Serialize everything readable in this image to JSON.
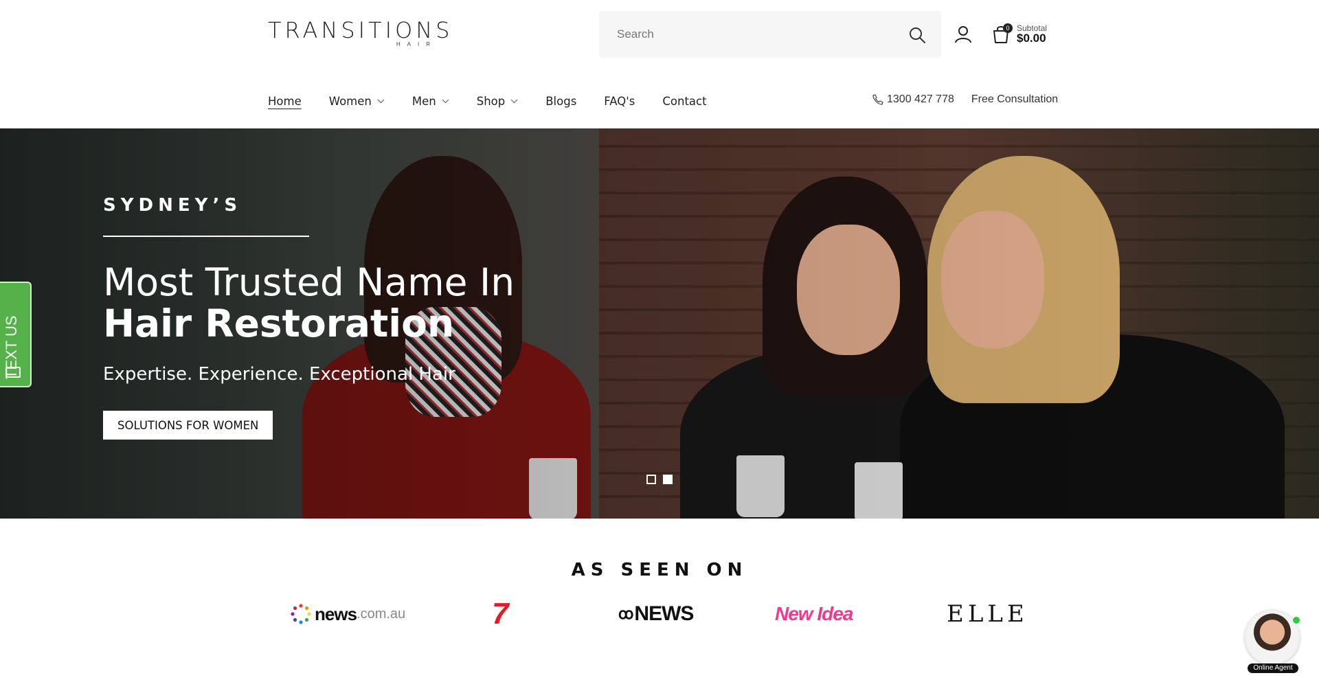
{
  "brand": {
    "name": "TRANSITIONS",
    "sub": "HAIR"
  },
  "search": {
    "placeholder": "Search"
  },
  "cart": {
    "count": "0",
    "subtotal_label": "Subtotal",
    "total": "$0.00"
  },
  "nav": {
    "items": [
      {
        "label": "Home",
        "active": true,
        "dropdown": false
      },
      {
        "label": "Women",
        "dropdown": true
      },
      {
        "label": "Men",
        "dropdown": true
      },
      {
        "label": "Shop",
        "dropdown": true
      },
      {
        "label": "Blogs",
        "dropdown": false
      },
      {
        "label": "FAQ's",
        "dropdown": false
      },
      {
        "label": "Contact",
        "dropdown": false
      }
    ],
    "phone": "1300 427 778",
    "consultation": "Free Consultation"
  },
  "hero": {
    "kicker": "SYDNEY’S",
    "headline_1": "Most Trusted Name In",
    "headline_2": "Hair Restoration",
    "subhead": "Expertise. Experience. Exceptional Hair",
    "cta": "SOLUTIONS FOR WOMEN",
    "slides": 2,
    "active_slide": 2
  },
  "text_us": {
    "label": "TEXT US",
    "color": "#55b24a"
  },
  "seen_on": {
    "title": "AS SEEN ON",
    "logos": {
      "news_main": "news",
      "news_domain": ".com.au",
      "seven": "7",
      "abc_mark": "ꝏ",
      "abc_text": "NEWS",
      "new_idea": "New Idea",
      "elle": "ELLE"
    }
  },
  "agent": {
    "label": "Online Agent"
  }
}
